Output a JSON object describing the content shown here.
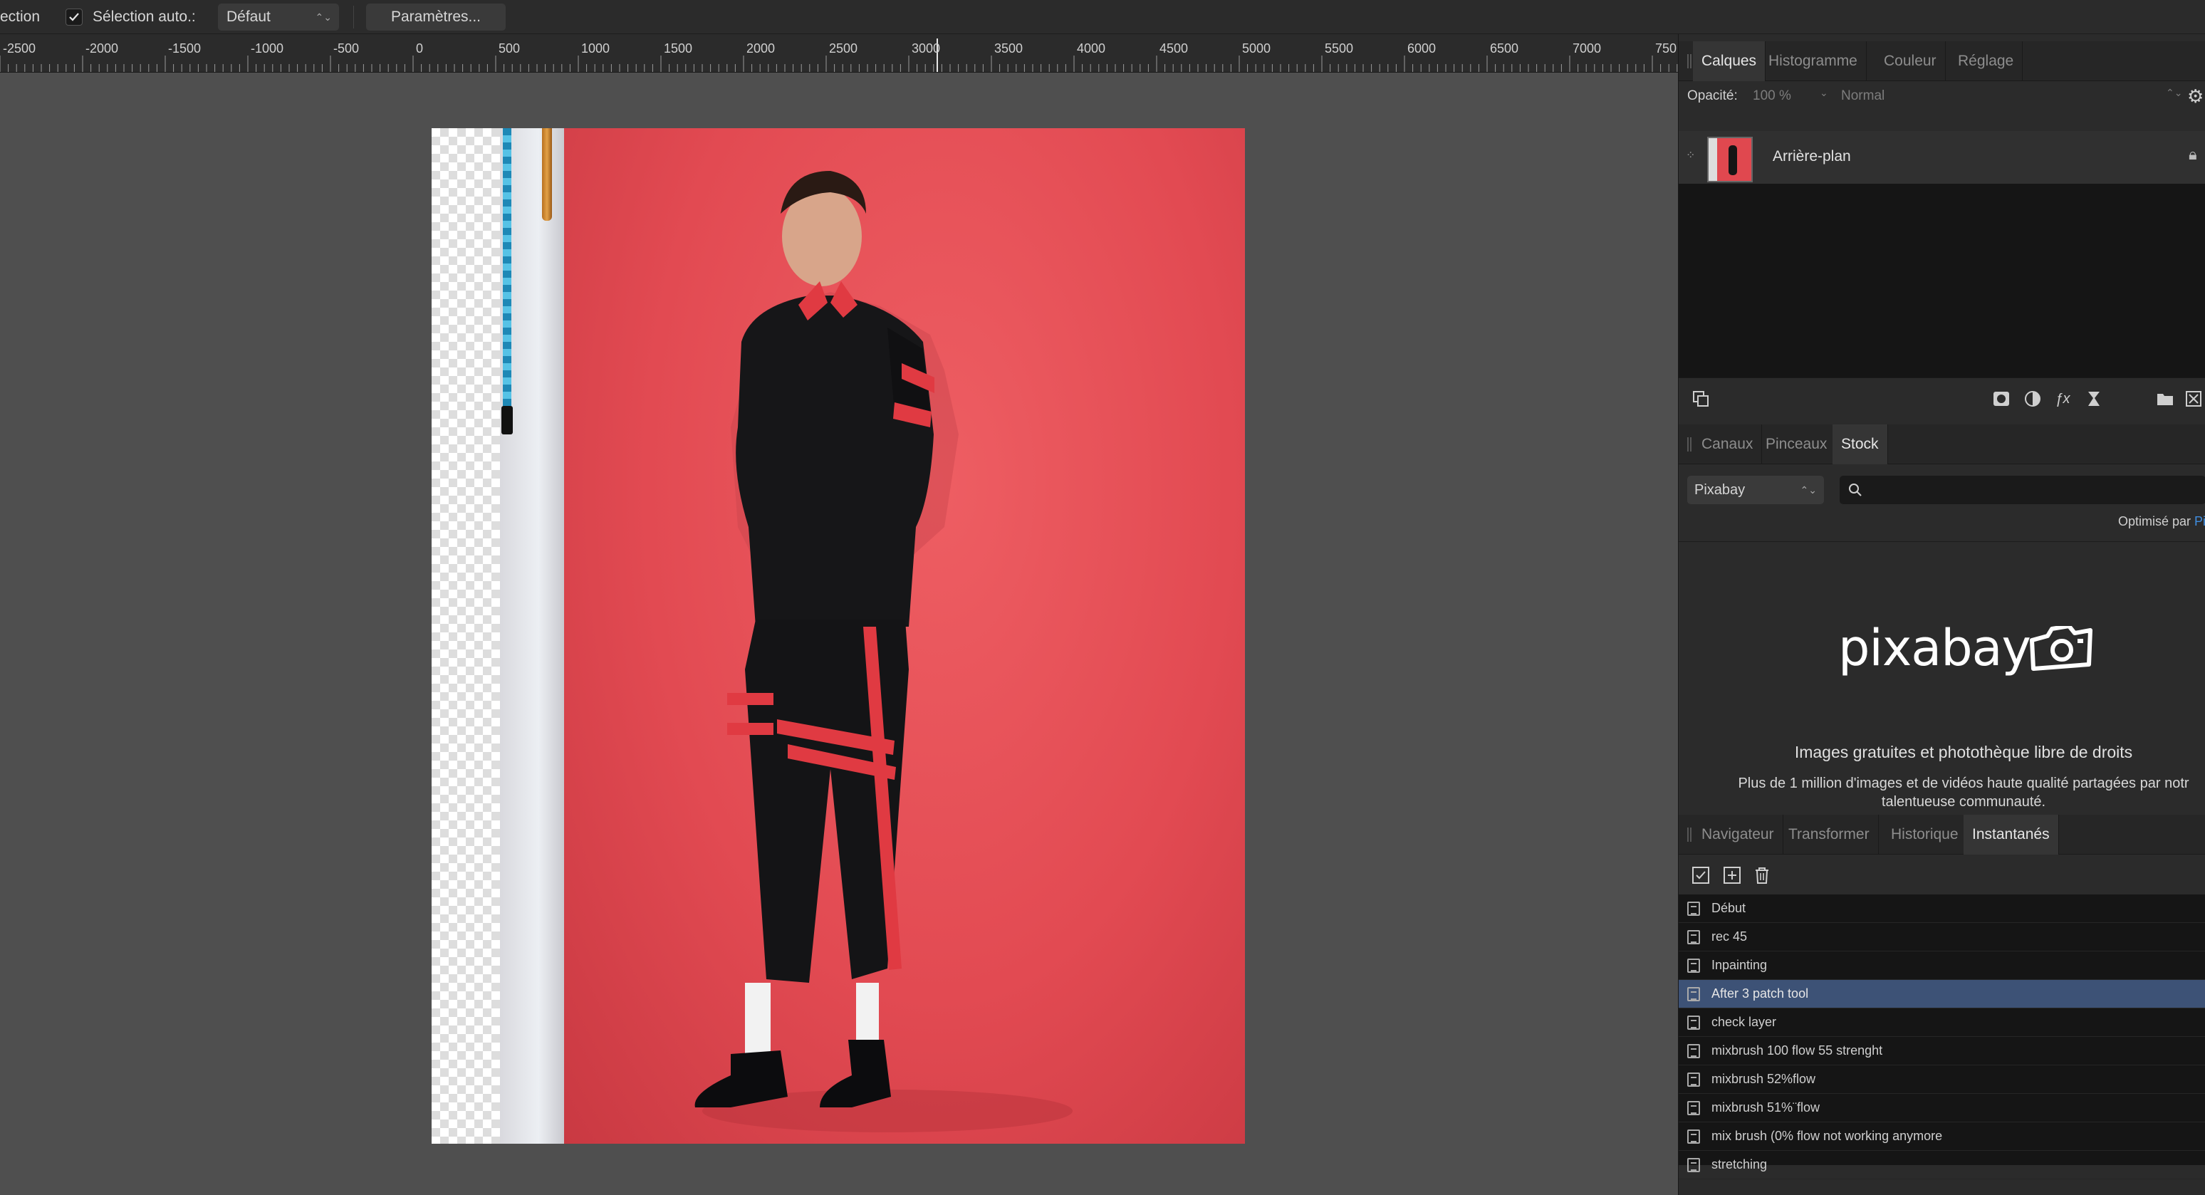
{
  "toolbar": {
    "selection_label": "ection",
    "auto_select_label": "Sélection auto.:",
    "auto_select_value": "Défaut",
    "params_button": "Paramètres..."
  },
  "ruler": {
    "labels": [
      "-2500",
      "-2000",
      "-1500",
      "-1000",
      "-500",
      "0",
      "500",
      "1000",
      "1500",
      "2000",
      "2500",
      "3000",
      "3500",
      "4000",
      "4500",
      "5000",
      "5500",
      "6000",
      "6500",
      "7000",
      "750"
    ]
  },
  "panel_top": {
    "tabs": [
      "Calques",
      "Histogramme",
      "Couleur",
      "Réglage"
    ],
    "opacity_label": "Opacité:",
    "opacity_value": "100 %",
    "blend_mode": "Normal",
    "layer_name": "Arrière-plan"
  },
  "panel_mid": {
    "tabs": [
      "Canaux",
      "Pinceaux",
      "Stock"
    ],
    "source": "Pixabay",
    "powered_by": "Optimisé par ",
    "powered_link": "Pi",
    "logo_text": "pixabay",
    "title": "Images gratuites et photothèque libre de droits",
    "desc_line1": "Plus de 1 million d'images et de vidéos haute qualité partagées par notr",
    "desc_line2": "talentueuse communauté."
  },
  "panel_bottom": {
    "tabs": [
      "Navigateur",
      "Transformer",
      "Historique",
      "Instantanés"
    ],
    "snapshots": [
      "Début",
      "rec 45",
      "Inpainting",
      "After 3 patch tool",
      "check layer",
      "mixbrush 100 flow 55 strenght",
      "mixbrush 52%flow",
      "mixbrush 51%¨flow",
      "mix brush (0% flow not working anymore",
      "stretching"
    ],
    "selected_index": 3
  },
  "colors": {
    "accent_selected": "#3d5276",
    "backdrop_red": "#e24a52",
    "link_blue": "#3f8de0"
  }
}
